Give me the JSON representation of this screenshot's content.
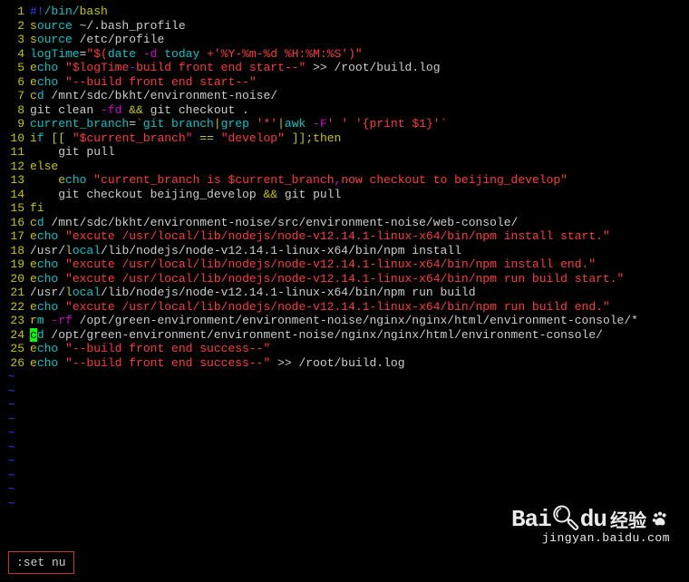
{
  "status_bar": ":set nu",
  "watermark": {
    "logo": "Bai",
    "logo2": "du",
    "jingyan": "经验",
    "url": "jingyan.baidu.com"
  },
  "lines": [
    {
      "n": 1,
      "tokens": [
        [
          "c-b",
          "#!"
        ],
        [
          "c-c",
          "/bin/"
        ],
        [
          "c-y",
          "bash"
        ]
      ]
    },
    {
      "n": 2,
      "tokens": [
        [
          "c-y",
          "s"
        ],
        [
          "c-c",
          "ource"
        ],
        [
          "c-w",
          " ~/.bash_profile"
        ]
      ]
    },
    {
      "n": 3,
      "tokens": [
        [
          "c-y",
          "s"
        ],
        [
          "c-c",
          "ource"
        ],
        [
          "c-w",
          " /etc/profile"
        ]
      ]
    },
    {
      "n": 4,
      "tokens": [
        [
          "c-c",
          "logTime"
        ],
        [
          "c-w",
          "="
        ],
        [
          "c-r",
          "\"$("
        ],
        [
          "c-c",
          "date "
        ],
        [
          "c-m",
          "-d"
        ],
        [
          "c-c",
          " today "
        ],
        [
          "c-r",
          "+'%Y-%m-%d %H:%M:%S'"
        ],
        [
          "c-r",
          ")\""
        ]
      ]
    },
    {
      "n": 5,
      "tokens": [
        [
          "c-y",
          "e"
        ],
        [
          "c-c",
          "cho"
        ],
        [
          "c-w",
          " "
        ],
        [
          "c-r",
          "\"$logTime"
        ],
        [
          "c-b",
          "-"
        ],
        [
          "c-r",
          "build front end start--\""
        ],
        [
          "c-w",
          " >> /root/build.log"
        ]
      ]
    },
    {
      "n": 6,
      "tokens": [
        [
          "c-y",
          "e"
        ],
        [
          "c-c",
          "cho"
        ],
        [
          "c-w",
          " "
        ],
        [
          "c-r",
          "\"--build front end start--\""
        ]
      ]
    },
    {
      "n": 7,
      "tokens": [
        [
          "c-y",
          "c"
        ],
        [
          "c-c",
          "d"
        ],
        [
          "c-w",
          " /mnt/sdc/bkht/environment-noise/"
        ]
      ]
    },
    {
      "n": 8,
      "tokens": [
        [
          "c-w",
          "git clean "
        ],
        [
          "c-m",
          "-fd"
        ],
        [
          "c-w",
          " "
        ],
        [
          "c-y",
          "&&"
        ],
        [
          "c-w",
          " git checkout ."
        ]
      ]
    },
    {
      "n": 9,
      "tokens": [
        [
          "c-c",
          "current_branch"
        ],
        [
          "c-w",
          "="
        ],
        [
          "c-r",
          "`"
        ],
        [
          "c-c",
          "git branch"
        ],
        [
          "c-y",
          "|"
        ],
        [
          "c-c",
          "grep "
        ],
        [
          "c-r",
          "'*'"
        ],
        [
          "c-y",
          "|"
        ],
        [
          "c-c",
          "awk "
        ],
        [
          "c-m",
          "-F"
        ],
        [
          "c-r",
          "' '"
        ],
        [
          "c-c",
          " "
        ],
        [
          "c-r",
          "'{print $1}'"
        ],
        [
          "c-r",
          "`"
        ]
      ]
    },
    {
      "n": 10,
      "tokens": [
        [
          "c-y",
          "i"
        ],
        [
          "c-c",
          "f"
        ],
        [
          "c-y",
          " [["
        ],
        [
          "c-w",
          " "
        ],
        [
          "c-r",
          "\"$current_branch\""
        ],
        [
          "c-w",
          " "
        ],
        [
          "c-y",
          "=="
        ],
        [
          "c-w",
          " "
        ],
        [
          "c-r",
          "\"develop\""
        ],
        [
          "c-w",
          " "
        ],
        [
          "c-y",
          "]];then"
        ]
      ]
    },
    {
      "n": 11,
      "tokens": [
        [
          "c-w",
          "    git pull"
        ]
      ]
    },
    {
      "n": 12,
      "tokens": [
        [
          "c-y",
          "else"
        ]
      ]
    },
    {
      "n": 13,
      "tokens": [
        [
          "c-w",
          "    "
        ],
        [
          "c-y",
          "e"
        ],
        [
          "c-c",
          "cho"
        ],
        [
          "c-w",
          " "
        ],
        [
          "c-r",
          "\"current_branch is $current_branch"
        ],
        [
          "c-m",
          ","
        ],
        [
          "c-r",
          "now checkout to beijing_develop\""
        ]
      ]
    },
    {
      "n": 14,
      "tokens": [
        [
          "c-w",
          "    git checkout beijing_develop "
        ],
        [
          "c-y",
          "&&"
        ],
        [
          "c-w",
          " git pull"
        ]
      ]
    },
    {
      "n": 15,
      "tokens": [
        [
          "c-y",
          "fi"
        ]
      ]
    },
    {
      "n": 16,
      "tokens": [
        [
          "c-y",
          "c"
        ],
        [
          "c-c",
          "d"
        ],
        [
          "c-w",
          " /mnt/sdc/bkht/environment-noise/src/environment-noise/web-console/"
        ]
      ]
    },
    {
      "n": 17,
      "tokens": [
        [
          "c-y",
          "e"
        ],
        [
          "c-c",
          "cho"
        ],
        [
          "c-w",
          " "
        ],
        [
          "c-r",
          "\"excute /usr/local/lib/nodejs/node-v12.14.1-linux-x64/bin/npm install start.\""
        ]
      ]
    },
    {
      "n": 18,
      "tokens": [
        [
          "c-w",
          "/usr/"
        ],
        [
          "c-y",
          "l"
        ],
        [
          "c-c",
          "ocal"
        ],
        [
          "c-w",
          "/lib/nodejs/node-v12.14.1-linux-x64/bin/npm install"
        ]
      ]
    },
    {
      "n": 19,
      "tokens": [
        [
          "c-y",
          "e"
        ],
        [
          "c-c",
          "cho"
        ],
        [
          "c-w",
          " "
        ],
        [
          "c-r",
          "\"excute /usr/local/lib/nodejs/node-v12.14.1-linux-x64/bin/npm install end.\""
        ]
      ]
    },
    {
      "n": 20,
      "tokens": [
        [
          "c-y",
          "e"
        ],
        [
          "c-c",
          "cho"
        ],
        [
          "c-w",
          " "
        ],
        [
          "c-r",
          "\"excute /usr/local/lib/nodejs/node-v12.14.1-linux-x64/bin/npm run build start.\""
        ]
      ]
    },
    {
      "n": 21,
      "tokens": [
        [
          "c-w",
          "/usr/"
        ],
        [
          "c-y",
          "l"
        ],
        [
          "c-c",
          "ocal"
        ],
        [
          "c-w",
          "/lib/nodejs/node-v12.14.1-linux-x64/bin/npm run build"
        ]
      ]
    },
    {
      "n": 22,
      "tokens": [
        [
          "c-y",
          "e"
        ],
        [
          "c-c",
          "cho"
        ],
        [
          "c-w",
          " "
        ],
        [
          "c-r",
          "\"excute /usr/local/lib/nodejs/node-v12.14.1-linux-x64/bin/npm run build end.\""
        ]
      ]
    },
    {
      "n": 23,
      "tokens": [
        [
          "c-y",
          "r"
        ],
        [
          "c-c",
          "m"
        ],
        [
          "c-w",
          " "
        ],
        [
          "c-m",
          "-rf"
        ],
        [
          "c-w",
          " /opt/green-environment/environment-noise/nginx/nginx/html/environment-console/*"
        ]
      ]
    },
    {
      "n": 24,
      "tokens": [
        [
          "cursor",
          "c"
        ],
        [
          "c-c",
          "d"
        ],
        [
          "c-w",
          " /opt/green-environment/environment-noise/nginx/nginx/html/environment-console/"
        ]
      ]
    },
    {
      "n": 25,
      "tokens": [
        [
          "c-y",
          "e"
        ],
        [
          "c-c",
          "cho"
        ],
        [
          "c-w",
          " "
        ],
        [
          "c-r",
          "\"--build front end success--\""
        ]
      ]
    },
    {
      "n": 26,
      "tokens": [
        [
          "c-y",
          "e"
        ],
        [
          "c-c",
          "cho"
        ],
        [
          "c-w",
          " "
        ],
        [
          "c-r",
          "\"--build front end success--\""
        ],
        [
          "c-w",
          " >> /root/build.log"
        ]
      ]
    }
  ],
  "tilde_lines": 10
}
